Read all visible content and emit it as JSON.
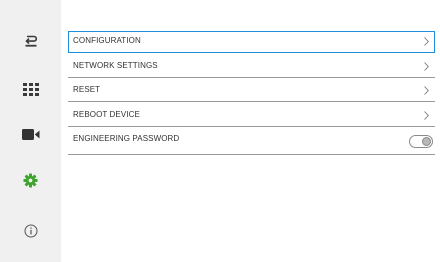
{
  "sidebar": {
    "items": [
      {
        "name": "back",
        "icon": "back-arrow-icon"
      },
      {
        "name": "apps",
        "icon": "grid-icon"
      },
      {
        "name": "camera",
        "icon": "video-camera-icon"
      },
      {
        "name": "settings",
        "icon": "gear-icon",
        "active_color": "#3fa32f"
      },
      {
        "name": "info",
        "icon": "info-icon"
      }
    ]
  },
  "menu": {
    "items": [
      {
        "label": "CONFIGURATION",
        "selected": true,
        "control": "chevron"
      },
      {
        "label": "NETWORK SETTINGS",
        "control": "chevron"
      },
      {
        "label": "RESET",
        "control": "chevron"
      },
      {
        "label": "REBOOT DEVICE",
        "control": "chevron"
      },
      {
        "label": "ENGINEERING PASSWORD",
        "control": "toggle",
        "toggle_on": false
      }
    ]
  },
  "colors": {
    "selection_border": "#1e8fdc",
    "settings_active": "#3fa32f"
  }
}
